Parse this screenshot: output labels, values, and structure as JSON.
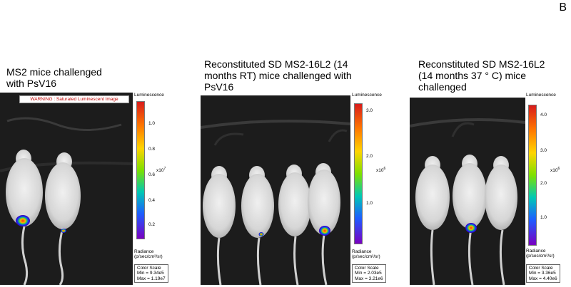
{
  "corner_label": "B",
  "panels": [
    {
      "caption": [
        "MS2 mice challenged",
        "with PsV16"
      ],
      "warning": "WARNING : Saturated Luminescent Image",
      "colorbar": {
        "title": "Luminescence",
        "ticks": [
          "1.0",
          "0.8",
          "0.6",
          "0.4",
          "0.2"
        ],
        "multiplier": "x10",
        "multiplier_exp": "7",
        "radiance_title": "Radiance",
        "radiance_units": "(p/sec/cm²/sr)",
        "scale_title": "Color Scale",
        "min": "Min = 9.34e5",
        "max": "Max = 1.19e7"
      }
    },
    {
      "caption": [
        "Reconstituted SD MS2-16L2 (14",
        "months RT) mice challenged with",
        "PsV16"
      ],
      "colorbar": {
        "title": "Luminescence",
        "ticks": [
          "3.0",
          "2.0",
          "1.0"
        ],
        "multiplier": "x10",
        "multiplier_exp": "6",
        "radiance_title": "Radiance",
        "radiance_units": "(p/sec/cm²/sr)",
        "scale_title": "Color Scale",
        "min": "Min = 2.03e5",
        "max": "Max = 3.21e6"
      }
    },
    {
      "caption": [
        "Reconstituted SD MS2-16L2",
        "(14 months 37 ° C) mice",
        "challenged"
      ],
      "colorbar": {
        "title": "Luminescence",
        "ticks": [
          "4.0",
          "3.0",
          "2.0",
          "1.0"
        ],
        "multiplier": "x10",
        "multiplier_exp": "6",
        "radiance_title": "Radiance",
        "radiance_units": "(p/sec/cm²/sr)",
        "scale_title": "Color Scale",
        "min": "Min = 3.36e5",
        "max": "Max = 4.40e6"
      }
    }
  ],
  "colors": {
    "background": "#1c1c1c",
    "mouse": "#e2e2e2",
    "signal_core": "#e0231a",
    "signal_ring": "#1433ff"
  }
}
